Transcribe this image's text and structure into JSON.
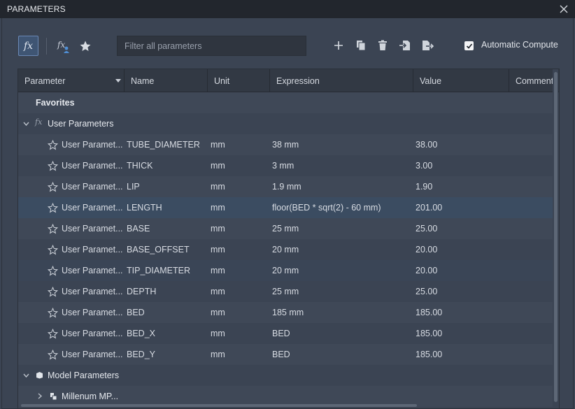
{
  "window": {
    "title": "PARAMETERS"
  },
  "toolbar": {
    "filter_placeholder": "Filter all parameters",
    "auto_compute_label": "Automatic Compute",
    "auto_compute_checked": true
  },
  "table": {
    "columns": [
      "Parameter",
      "Name",
      "Unit",
      "Expression",
      "Value",
      "Comment"
    ],
    "groups": {
      "favorites": "Favorites",
      "user_parameters": "User Parameters",
      "model_parameters": "Model Parameters",
      "model_child": "Millenum MP..."
    },
    "rows": [
      {
        "parameter": "User Paramet...",
        "name": "TUBE_DIAMETER",
        "unit": "mm",
        "expression": "38 mm",
        "value": "38.00"
      },
      {
        "parameter": "User Paramet...",
        "name": "THICK",
        "unit": "mm",
        "expression": "3 mm",
        "value": "3.00"
      },
      {
        "parameter": "User Paramet...",
        "name": "LIP",
        "unit": "mm",
        "expression": "1.9 mm",
        "value": "1.90"
      },
      {
        "parameter": "User Paramet...",
        "name": "LENGTH",
        "unit": "mm",
        "expression": "floor(BED * sqrt(2) - 60 mm)",
        "value": "201.00"
      },
      {
        "parameter": "User Paramet...",
        "name": "BASE",
        "unit": "mm",
        "expression": "25 mm",
        "value": "25.00"
      },
      {
        "parameter": "User Paramet...",
        "name": "BASE_OFFSET",
        "unit": "mm",
        "expression": "20 mm",
        "value": "20.00"
      },
      {
        "parameter": "User Paramet...",
        "name": "TIP_DIAMETER",
        "unit": "mm",
        "expression": "20 mm",
        "value": "20.00"
      },
      {
        "parameter": "User Paramet...",
        "name": "DEPTH",
        "unit": "mm",
        "expression": "25 mm",
        "value": "25.00"
      },
      {
        "parameter": "User Paramet...",
        "name": "BED",
        "unit": "mm",
        "expression": "185 mm",
        "value": "185.00"
      },
      {
        "parameter": "User Paramet...",
        "name": "BED_X",
        "unit": "mm",
        "expression": "BED",
        "value": "185.00"
      },
      {
        "parameter": "User Paramet...",
        "name": "BED_Y",
        "unit": "mm",
        "expression": "BED",
        "value": "185.00"
      }
    ]
  },
  "colors": {
    "background": "#3b4453",
    "titlebar": "#22262d",
    "selected_row": "#3b4c61",
    "accent": "#6a88b5"
  },
  "icons": [
    "fx-icon",
    "fx-user-icon",
    "star-icon",
    "add-icon",
    "copy-icon",
    "delete-icon",
    "import-icon",
    "export-icon",
    "close-icon",
    "star-outline-icon",
    "chevron-down-icon",
    "chevron-right-icon",
    "component-icon",
    "model-parameters-icon",
    "checkmark-icon",
    "sort-arrow-icon"
  ]
}
